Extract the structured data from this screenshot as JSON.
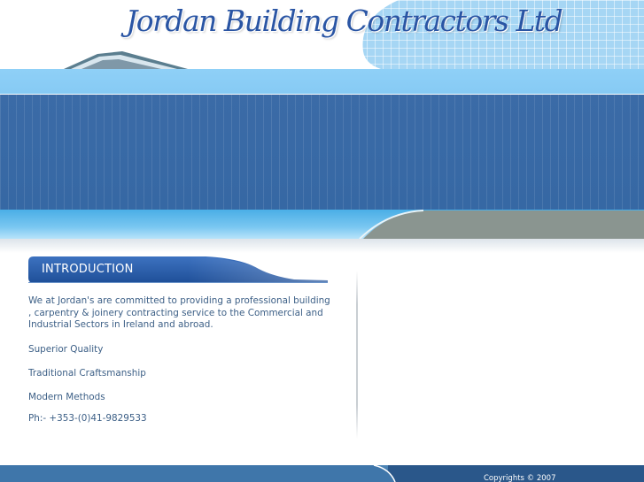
{
  "header": {
    "site_title": "Jordan Building Contractors Ltd"
  },
  "intro": {
    "section_title": "Introduction",
    "paragraph": "We at Jordan's are committed to providing a professional building , carpentry & joinery contracting service to the Commercial and Industrial Sectors in Ireland and abroad.",
    "features": [
      "Superior Quality",
      "Traditional Craftsmanship",
      "Modern Methods"
    ],
    "phone": "Ph:- +353-(0)41-9829533"
  },
  "footer": {
    "copyright": "Copyrights © 2007"
  },
  "colors": {
    "title_blue": "#2a55a4",
    "banner_blue": "#3a6aa6",
    "light_blue": "#8fd0f7",
    "body_text": "#3c5f86",
    "grey_band": "#8a9590"
  }
}
